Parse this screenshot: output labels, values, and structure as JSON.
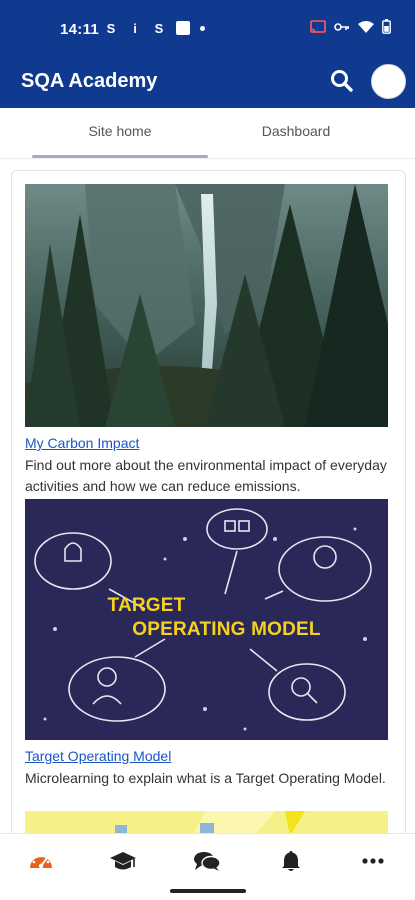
{
  "status_bar": {
    "time": "14:11",
    "left_icons": [
      "S",
      "i",
      "S"
    ]
  },
  "app_bar": {
    "title": "SQA Academy",
    "search_icon": "search-icon",
    "avatar_icon": "user-avatar"
  },
  "tabs": [
    {
      "label": "Site home",
      "active": true
    },
    {
      "label": "Dashboard",
      "active": false
    }
  ],
  "courses": [
    {
      "title": "My Carbon Impact",
      "description": "Find out more about the environmental impact of everyday activities and how we can reduce emissions.",
      "image": "forest-waterfall"
    },
    {
      "title": "Target Operating Model",
      "description": "Microlearning to explain what is a Target Operating Model.",
      "image": "target-operating-model",
      "image_text_line1": "TARGET",
      "image_text_line2": "OPERATING MODEL"
    }
  ],
  "bottom_nav": [
    {
      "icon": "dashboard-icon",
      "active": true
    },
    {
      "icon": "graduation-cap-icon",
      "active": false
    },
    {
      "icon": "chat-icon",
      "active": false
    },
    {
      "icon": "bell-icon",
      "active": false
    },
    {
      "icon": "more-icon",
      "active": false
    }
  ],
  "colors": {
    "primary": "#0f3a8f",
    "link": "#1a56c4",
    "accent": "#e8621b",
    "tab_indicator": "#a7a8cf",
    "tom_bg": "#2a2858",
    "tom_text": "#f7d21c"
  }
}
